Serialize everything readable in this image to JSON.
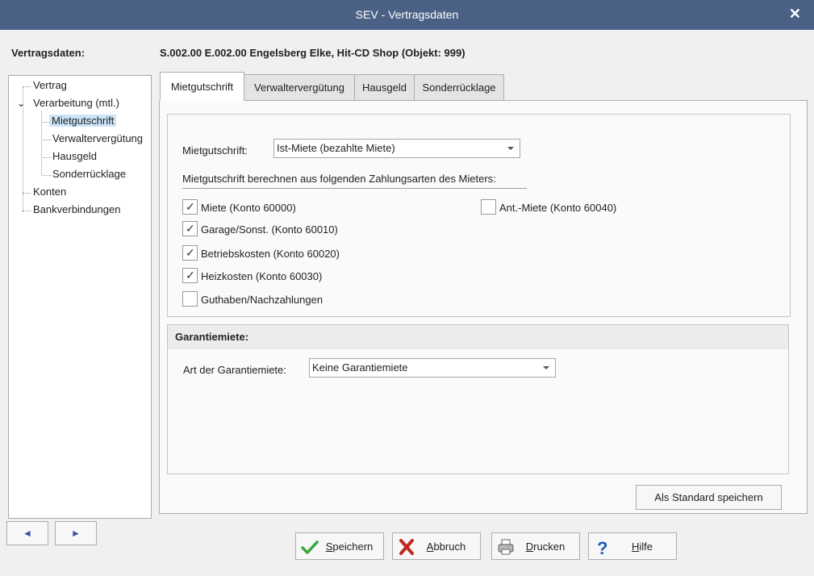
{
  "window": {
    "title": "SEV - Vertragsdaten"
  },
  "left_label": "Vertragsdaten:",
  "header": "S.002.00 E.002.00 Engelsberg Elke, Hit-CD Shop (Objekt: 999)",
  "tree": {
    "items": [
      {
        "label": "Vertrag"
      },
      {
        "label": "Verarbeitung (mtl.)"
      },
      {
        "label": "Mietgutschrift"
      },
      {
        "label": "Verwaltervergütung"
      },
      {
        "label": "Hausgeld"
      },
      {
        "label": "Sonderrücklage"
      },
      {
        "label": "Konten"
      },
      {
        "label": "Bankverbindungen"
      }
    ],
    "selected": "Mietgutschrift"
  },
  "nav": {
    "prev": "◄",
    "next": "►"
  },
  "tabs": [
    {
      "label": "Mietgutschrift"
    },
    {
      "label": "Verwaltervergütung"
    },
    {
      "label": "Hausgeld"
    },
    {
      "label": "Sonderrücklage"
    }
  ],
  "mietgutschrift": {
    "label": "Mietgutschrift:",
    "value": "Ist-Miete (bezahlte Miete)",
    "section_title": "Mietgutschrift berechnen aus folgenden Zahlungsarten des Mieters:",
    "checkboxes": [
      {
        "label": "Miete (Konto 60000)",
        "checked": true
      },
      {
        "label": "Garage/Sonst. (Konto 60010)",
        "checked": true
      },
      {
        "label": "Betriebskosten (Konto 60020)",
        "checked": true
      },
      {
        "label": "Heizkosten (Konto 60030)",
        "checked": true
      },
      {
        "label": "Guthaben/Nachzahlungen",
        "checked": false
      },
      {
        "label": "Ant.-Miete (Konto 60040)",
        "checked": false
      }
    ]
  },
  "garantiemiete": {
    "title": "Garantiemiete:",
    "label": "Art der Garantiemiete:",
    "value": "Keine Garantiemiete"
  },
  "buttons": {
    "standard": "Als Standard speichern",
    "save_u": "S",
    "save_rest": "peichern",
    "cancel_u": "A",
    "cancel_rest": "bbruch",
    "print_u": "D",
    "print_rest": "rucken",
    "help_u": "H",
    "help_rest": "ilfe"
  },
  "colors": {
    "titlebar": "#4a6185",
    "selection": "#cce4f7",
    "check": "#3a3a3a"
  }
}
